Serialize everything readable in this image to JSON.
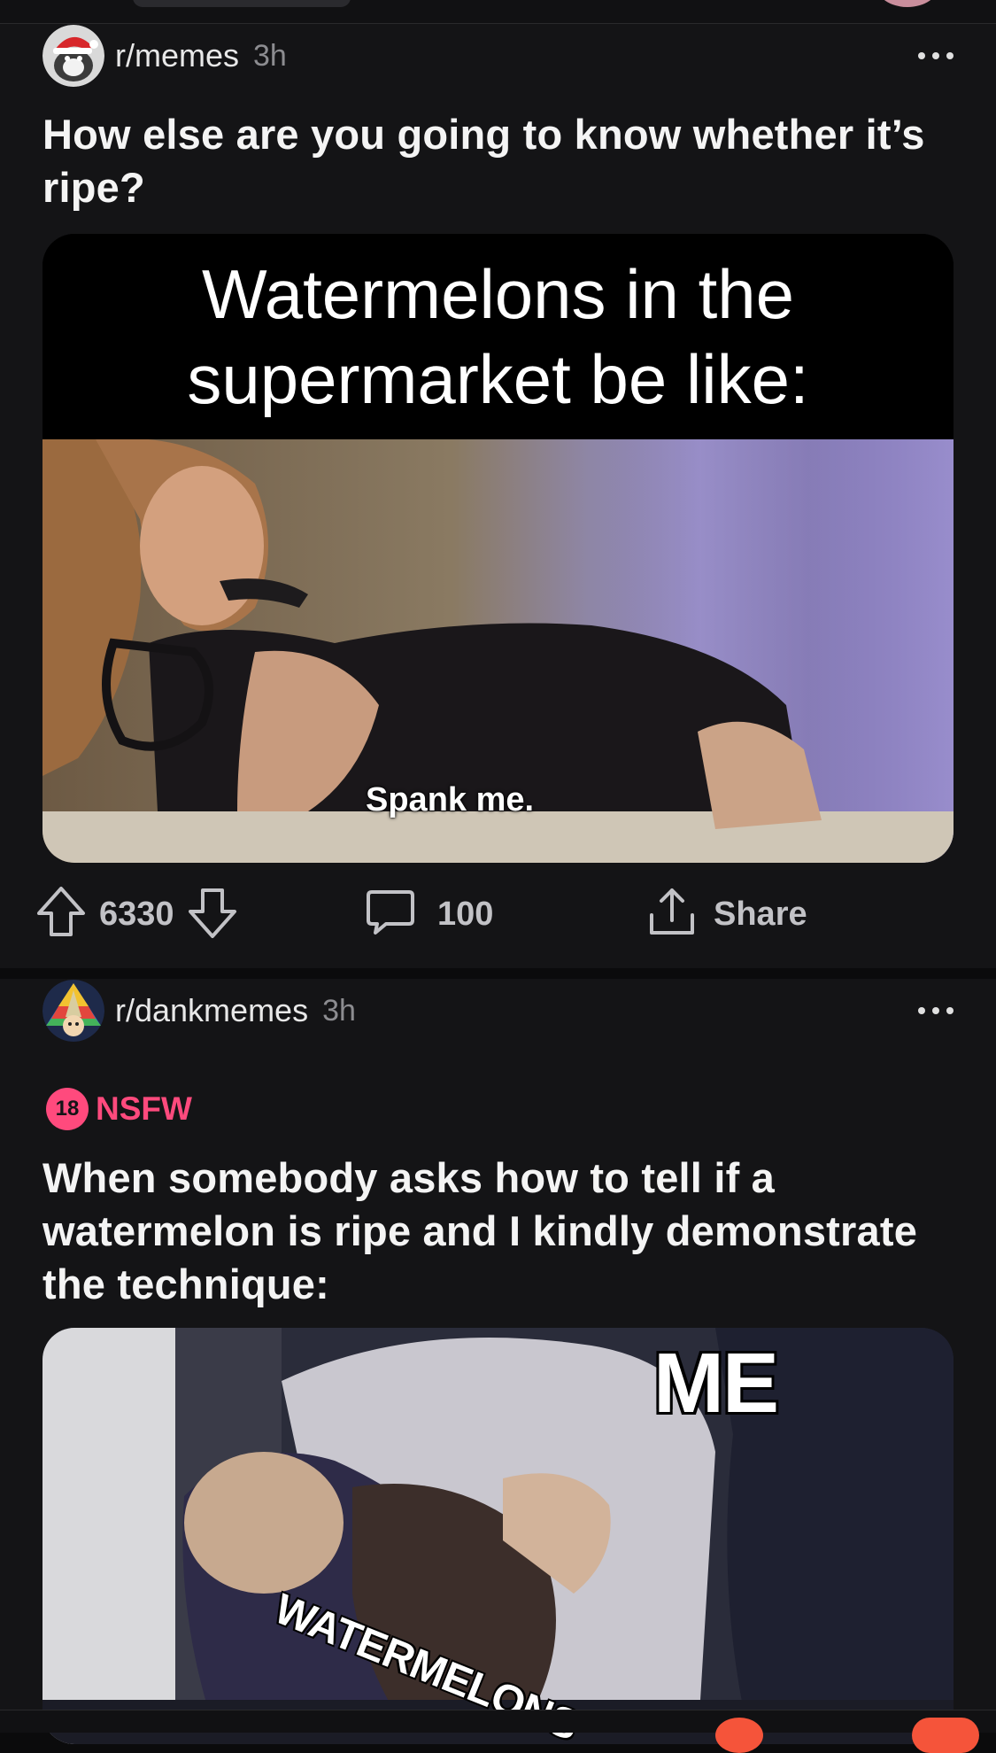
{
  "feed": {
    "posts": [
      {
        "subreddit": "r/memes",
        "age": "3h",
        "title": "How else are you going to know whether it’s ripe?",
        "meme_caption": "Watermelons in the supermarket be like:",
        "meme_overlay": "Spank me.",
        "upvotes": "6330",
        "comments": "100",
        "share_label": "Share"
      },
      {
        "subreddit": "r/dankmemes",
        "age": "3h",
        "nsfw_number": "18",
        "nsfw_label": "NSFW",
        "title": "When somebody asks how to tell if a watermelon is ripe and I kindly demonstrate the technique:",
        "meme_label_top": "ME",
        "meme_label_bottom": "WATERMELONS"
      }
    ]
  },
  "icons": {
    "upvote": "arrow-up-icon",
    "downvote": "arrow-down-icon",
    "comment": "comment-bubble-icon",
    "share": "share-icon",
    "more": "more-options-icon"
  },
  "colors": {
    "background": "#0b0b0c",
    "card": "#141416",
    "nsfw_accent": "#ff4a7d",
    "notification": "#f5543a"
  }
}
